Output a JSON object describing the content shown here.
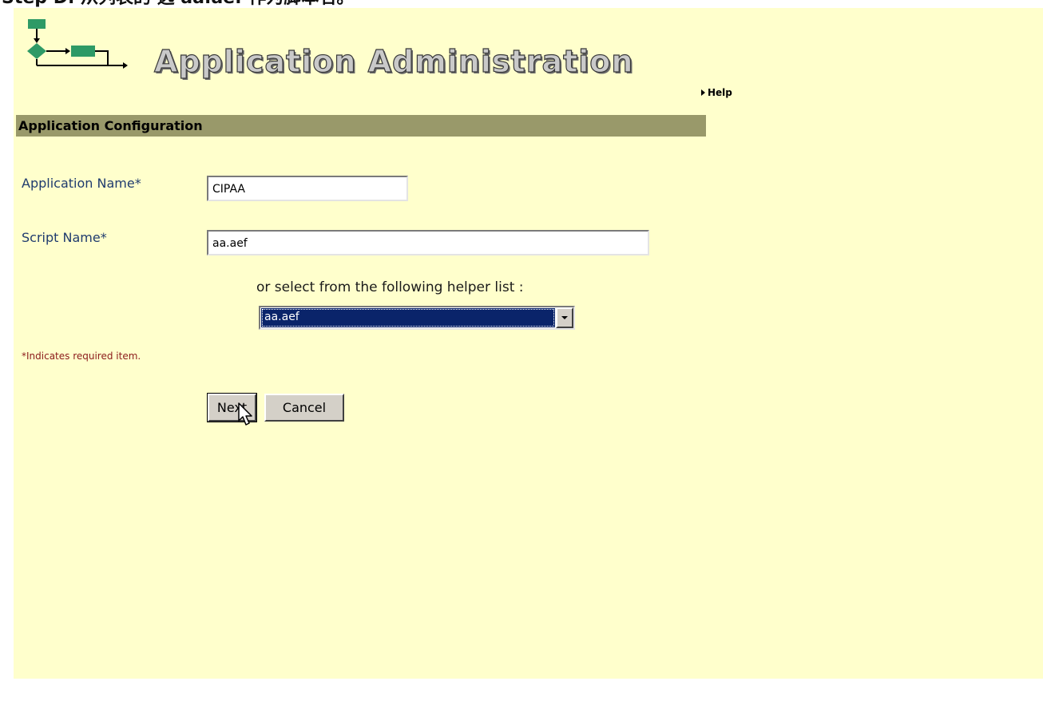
{
  "caption": "Step D. 从列表的 选 aa.aef 作为脚本名。",
  "header": {
    "title": "Application Administration",
    "help_label": "Help"
  },
  "section": {
    "title": "Application Configuration"
  },
  "form": {
    "application_name": {
      "label": "Application Name*",
      "value": "CIPAA"
    },
    "script_name": {
      "label": "Script Name*",
      "value": "aa.aef"
    },
    "helper_text": "or select from the following helper list :",
    "helper_select": {
      "selected": "aa.aef"
    },
    "required_note": "*Indicates required item."
  },
  "buttons": {
    "next_label": "Next",
    "cancel_label": "Cancel"
  },
  "colors": {
    "page_background": "#ffffcc",
    "section_bar": "#99996a",
    "label_text": "#1f3b6e",
    "required_note": "#8b1a1a",
    "select_highlight": "#0a246a",
    "logo_green": "#2e9a66"
  },
  "icons": {
    "logo": "workflow-diagram-icon",
    "help_bullet": "triangle-right-icon",
    "dropdown": "chevron-down-icon",
    "pointer": "mouse-cursor-icon"
  }
}
